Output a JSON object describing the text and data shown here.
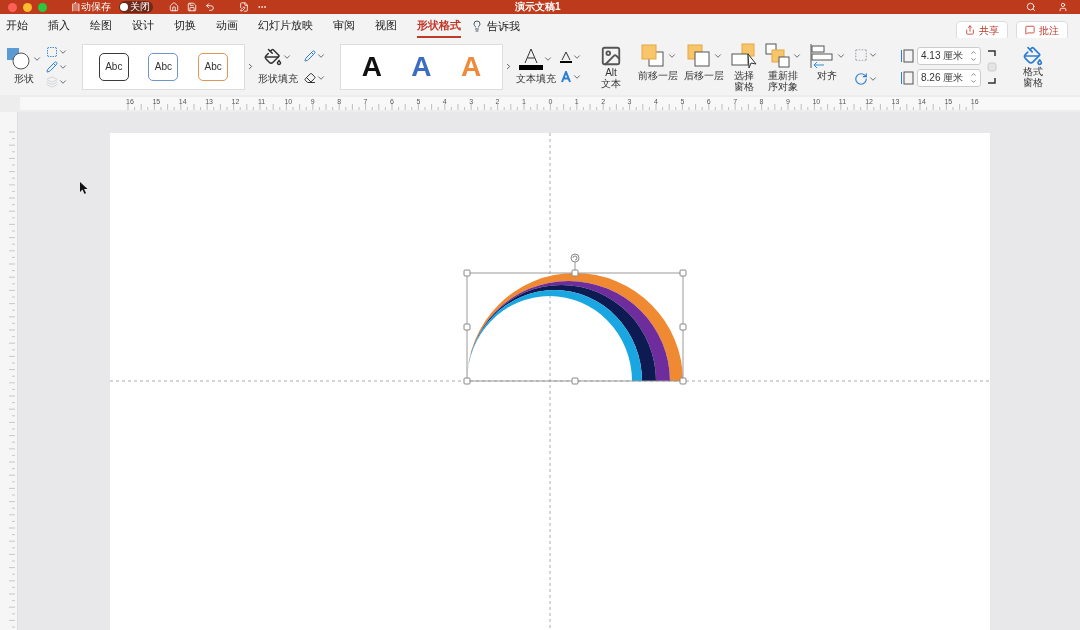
{
  "title_bar": {
    "autosave_label": "自动保存",
    "autosave_toggle": {
      "label": "关闭",
      "on": false
    },
    "document_title": "演示文稿1"
  },
  "tabs": [
    {
      "label": "开始",
      "selected": false
    },
    {
      "label": "插入",
      "selected": false
    },
    {
      "label": "绘图",
      "selected": false
    },
    {
      "label": "设计",
      "selected": false
    },
    {
      "label": "切换",
      "selected": false
    },
    {
      "label": "动画",
      "selected": false
    },
    {
      "label": "幻灯片放映",
      "selected": false
    },
    {
      "label": "审阅",
      "selected": false
    },
    {
      "label": "视图",
      "selected": false
    },
    {
      "label": "形状格式",
      "selected": true
    }
  ],
  "tell_me": "告诉我",
  "share_button": "共享",
  "comments_button": "批注",
  "ribbon": {
    "shapes_label": "形状",
    "shape_styles": [
      {
        "label": "Abc",
        "color": "#3a3a3a"
      },
      {
        "label": "Abc",
        "color": "#6f95cf"
      },
      {
        "label": "Abc",
        "color": "#e0955a"
      }
    ],
    "shape_fill_label": "形状填充",
    "wordart_styles": [
      {
        "label": "A",
        "color": "#111111"
      },
      {
        "label": "A",
        "color": "#3d6dc0"
      },
      {
        "label": "A",
        "color": "#ef8a3c"
      }
    ],
    "text_fill_label": "文本填充",
    "alt_text": [
      "Alt",
      "文本"
    ],
    "arrange": [
      {
        "kind": "forward",
        "label": [
          "前移一层"
        ]
      },
      {
        "kind": "backward",
        "label": [
          "后移一层"
        ]
      },
      {
        "kind": "pane",
        "label": [
          "选择",
          "窗格"
        ]
      },
      {
        "kind": "reorder",
        "label": [
          "重新排",
          "序对象"
        ]
      },
      {
        "kind": "align",
        "label": [
          "对齐"
        ]
      }
    ],
    "height_field": "4.13 厘米",
    "width_field": "8.26 厘米",
    "format_pane": [
      "格式",
      "窗格"
    ]
  },
  "ruler_labels": [
    "16",
    "15",
    "14",
    "13",
    "12",
    "11",
    "10",
    "9",
    "8",
    "7",
    "6",
    "5",
    "4",
    "3",
    "2",
    "1",
    "0",
    "1",
    "2",
    "3",
    "4",
    "5",
    "6",
    "7",
    "8",
    "9",
    "10",
    "11",
    "12",
    "13",
    "14",
    "15",
    "16"
  ]
}
